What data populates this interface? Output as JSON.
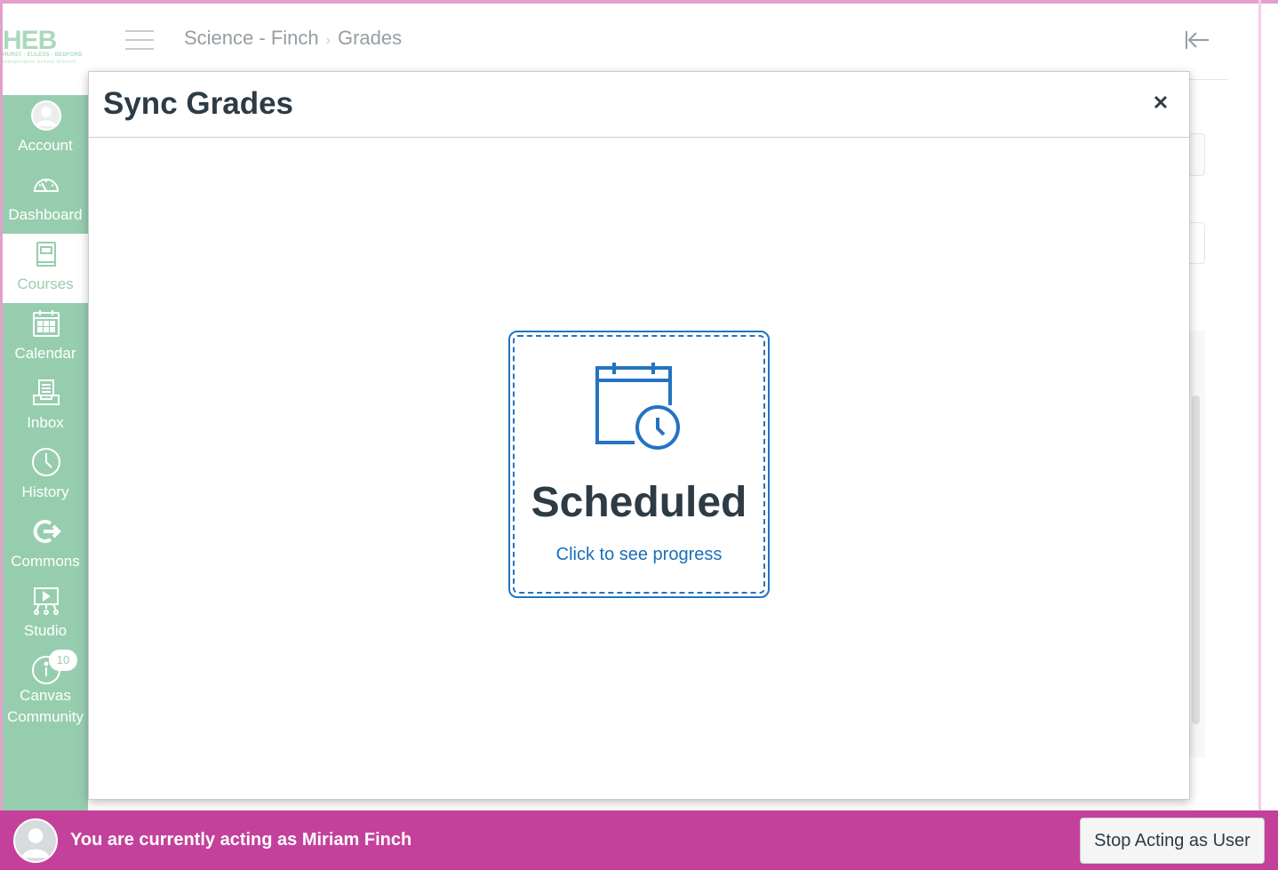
{
  "app": {
    "logo_text": "HEB",
    "logo_subtitle": "HURST · EULESS · BEDFORD",
    "logo_subtitle2": "Independent School District"
  },
  "global_nav": {
    "items": [
      {
        "label": "Account",
        "icon": "user-avatar-icon"
      },
      {
        "label": "Dashboard",
        "icon": "dashboard-gauge-icon"
      },
      {
        "label": "Courses",
        "icon": "courses-book-icon",
        "active": true
      },
      {
        "label": "Calendar",
        "icon": "calendar-icon"
      },
      {
        "label": "Inbox",
        "icon": "inbox-icon"
      },
      {
        "label": "History",
        "icon": "clock-icon"
      },
      {
        "label": "Commons",
        "icon": "commons-icon"
      },
      {
        "label": "Studio",
        "icon": "studio-icon"
      },
      {
        "label": "Canvas Community",
        "label_line1": "Canvas",
        "label_line2": "Community",
        "icon": "help-icon",
        "badge": "10"
      }
    ]
  },
  "header": {
    "breadcrumb": [
      "Science - Finch",
      "Grades"
    ],
    "breadcrumb_separator": "›"
  },
  "modal": {
    "title": "Sync Grades",
    "close_label": "×",
    "status": {
      "title": "Scheduled",
      "link": "Click to see progress",
      "icon": "calendar-clock-icon"
    }
  },
  "masquerade": {
    "message": "You are currently acting as Miriam Finch",
    "stop_button": "Stop Acting as User"
  },
  "colors": {
    "nav_green": "#2e9b5e",
    "masquerade_pink": "#c4419b",
    "link_blue": "#1a6fb8",
    "card_blue": "#2473c2",
    "text_dark": "#2d3b45"
  }
}
